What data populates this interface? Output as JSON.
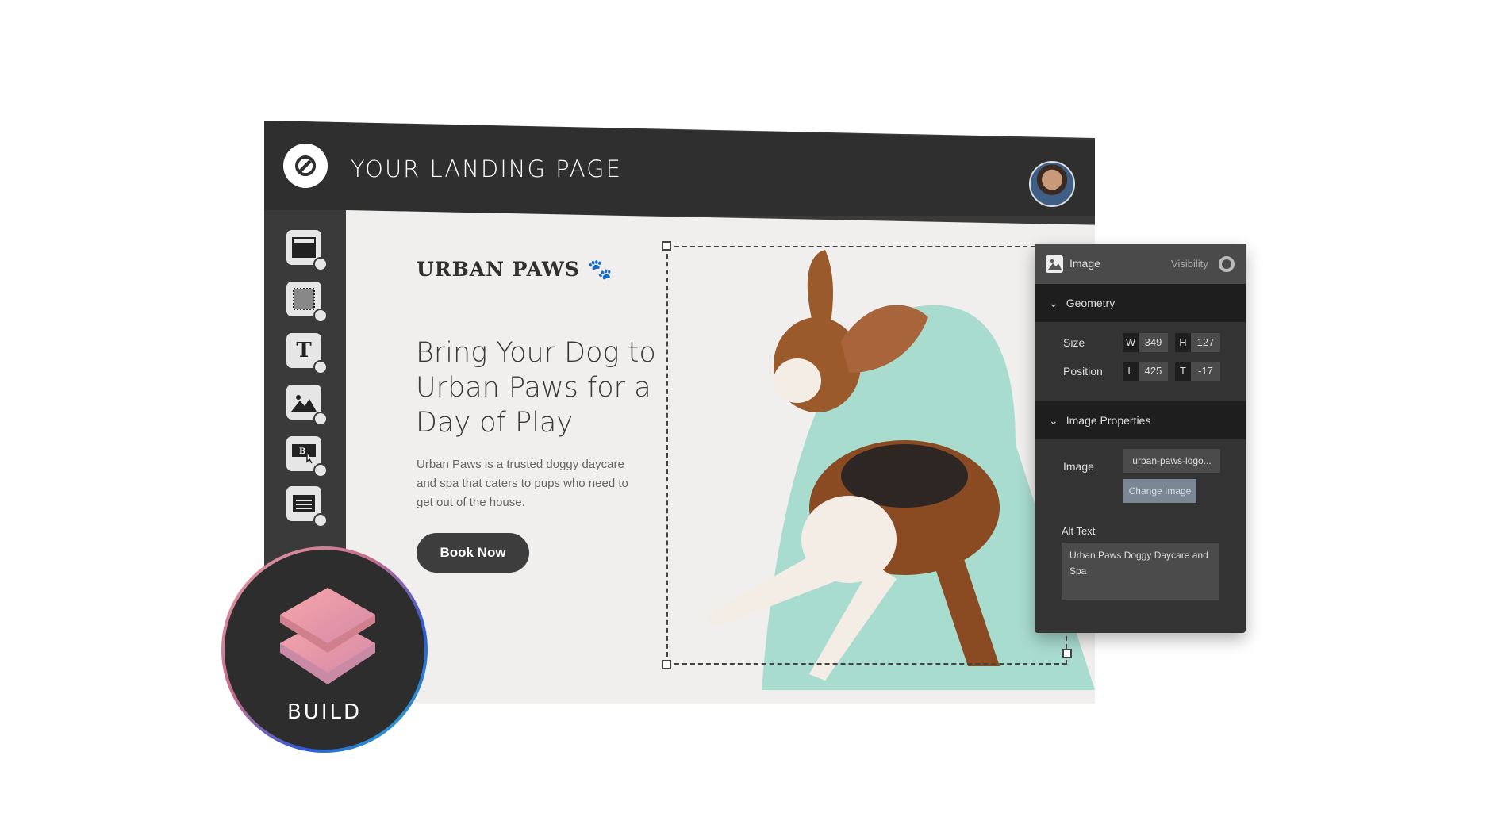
{
  "header": {
    "title": "YOUR LANDING PAGE",
    "logo": "unbounce-logo",
    "avatar": "user-avatar"
  },
  "sidebar": {
    "tools": [
      {
        "icon": "section-icon"
      },
      {
        "icon": "box-icon"
      },
      {
        "icon": "text-icon",
        "glyph": "T"
      },
      {
        "icon": "image-icon"
      },
      {
        "icon": "button-icon"
      },
      {
        "icon": "form-icon"
      }
    ]
  },
  "landing": {
    "brand": "URBAN PAWS",
    "headline": "Bring Your Dog to Urban Paws for a Day of Play",
    "body": "Urban Paws is a trusted doggy daycare and spa that caters to pups who need to get out of the house.",
    "cta": "Book Now",
    "accent": "#a8dccf"
  },
  "panel": {
    "title": "Image",
    "visibility": "Visibility",
    "geometry": {
      "label": "Geometry",
      "size_label": "Size",
      "position_label": "Position",
      "w_tag": "W",
      "w": "349",
      "h_tag": "H",
      "h": "127",
      "l_tag": "L",
      "l": "425",
      "t_tag": "T",
      "t": "-17"
    },
    "image_properties": {
      "label": "Image Properties",
      "image_label": "Image",
      "image_value": "urban-paws-logo...",
      "change_button": "Change Image",
      "alt_label": "Alt Text",
      "alt_value": "Urban Paws Doggy Daycare and Spa"
    }
  },
  "badge": {
    "label": "BUILD"
  }
}
